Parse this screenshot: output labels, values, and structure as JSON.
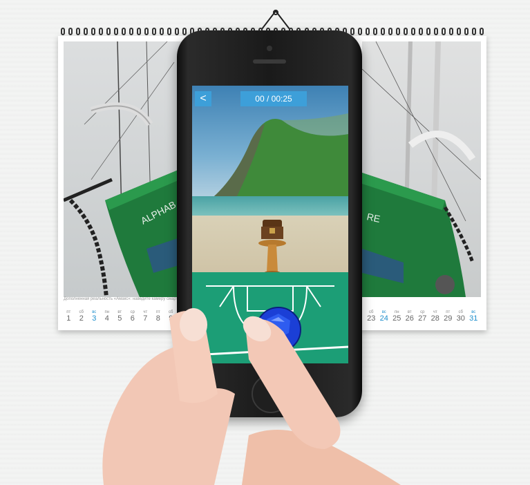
{
  "app": {
    "back_label": "<",
    "timer": "00 / 00:25"
  },
  "calendar": {
    "caption": "Дополненная реальность «Амакс»: наведите камеру смартфона…",
    "days_left": [
      {
        "wd": "пт",
        "num": "1",
        "hl": false
      },
      {
        "wd": "сб",
        "num": "2",
        "hl": false
      },
      {
        "wd": "вс",
        "num": "3",
        "hl": true
      },
      {
        "wd": "пн",
        "num": "4",
        "hl": false
      },
      {
        "wd": "вт",
        "num": "5",
        "hl": false
      },
      {
        "wd": "ср",
        "num": "6",
        "hl": false
      },
      {
        "wd": "чт",
        "num": "7",
        "hl": false
      },
      {
        "wd": "пт",
        "num": "8",
        "hl": false
      },
      {
        "wd": "сб",
        "num": "9",
        "hl": false
      }
    ],
    "days_right": [
      {
        "wd": "сб",
        "num": "23",
        "hl": false
      },
      {
        "wd": "вс",
        "num": "24",
        "hl": true
      },
      {
        "wd": "пн",
        "num": "25",
        "hl": false
      },
      {
        "wd": "вт",
        "num": "26",
        "hl": false
      },
      {
        "wd": "ср",
        "num": "27",
        "hl": false
      },
      {
        "wd": "чт",
        "num": "28",
        "hl": false
      },
      {
        "wd": "пт",
        "num": "29",
        "hl": false
      },
      {
        "wd": "сб",
        "num": "30",
        "hl": false
      },
      {
        "wd": "вс",
        "num": "31",
        "hl": true
      }
    ],
    "ship_name_left": "ALPHAB",
    "ship_name_right": "RE"
  },
  "colors": {
    "accent": "#3d9fd9",
    "ship_green": "#1f7a3c",
    "court_green": "#1c9e76",
    "ball_blue": "#1b3fd6"
  },
  "icons": [
    "back-arrow-icon",
    "treasure-chest-icon",
    "blue-ball-icon",
    "home-button-icon"
  ]
}
